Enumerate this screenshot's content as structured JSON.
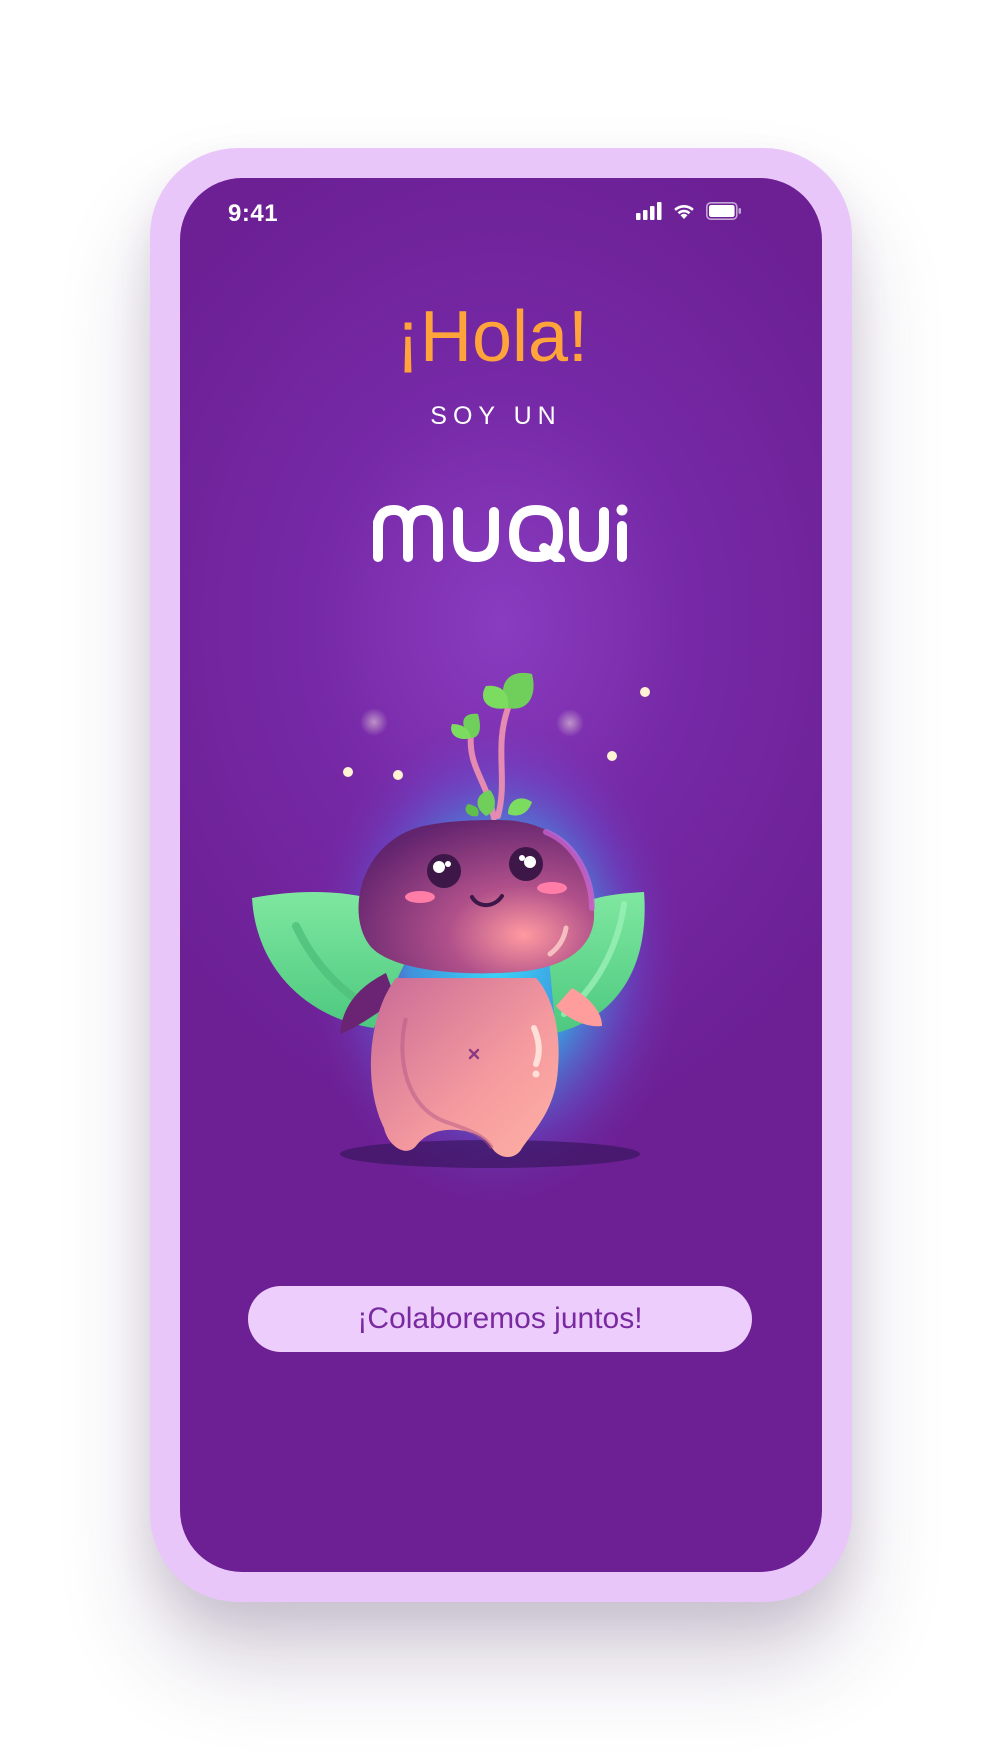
{
  "status_bar": {
    "time": "9:41",
    "icons": [
      "cellular-signal-icon",
      "wifi-icon",
      "battery-icon"
    ]
  },
  "welcome": {
    "greeting": "¡Hola!",
    "subtitle": "SOY UN",
    "logo_text": "muqui"
  },
  "mascot": {
    "name": "muqui-mascot-illustration"
  },
  "cta": {
    "label": "¡Colaboremos juntos!"
  },
  "colors": {
    "frame": "#e9c6fa",
    "screen_background": "#7629a6",
    "greeting": "#ffa43a",
    "button_background": "#eccdfb",
    "button_text": "#7a2aa0",
    "wings": "#6fdc8c",
    "body": "#f49a9e",
    "glow": "#2fd0f2"
  }
}
